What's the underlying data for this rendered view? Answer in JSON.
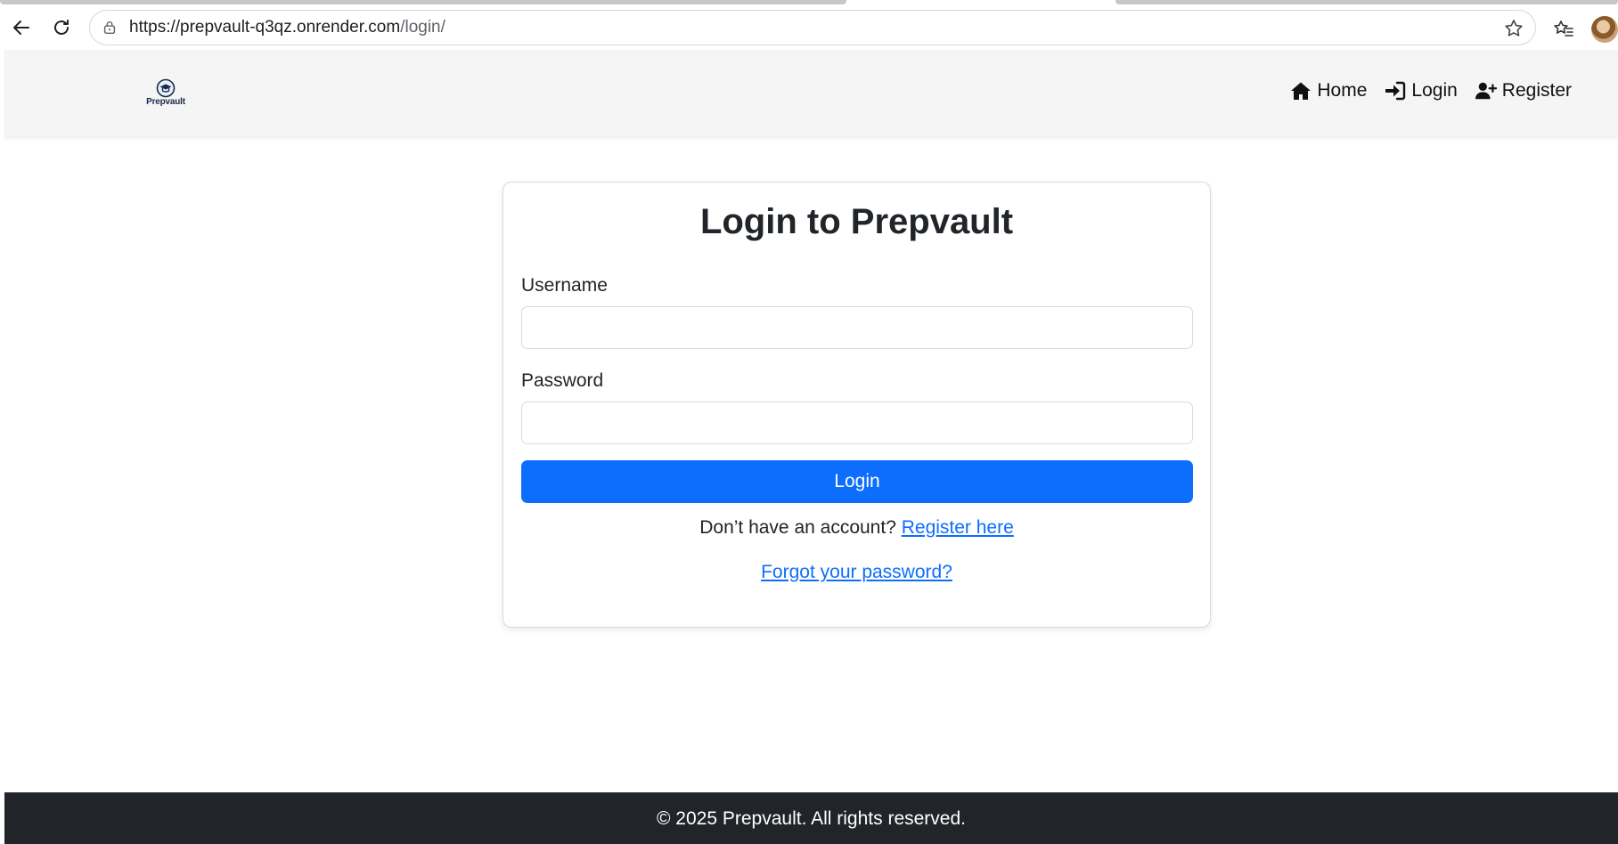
{
  "browser": {
    "url_host": "https://prepvault-q3qz.onrender.com",
    "url_path": "/login/"
  },
  "navbar": {
    "logo_text": "Prepvault",
    "links": [
      {
        "label": "Home",
        "icon": "home-icon"
      },
      {
        "label": "Login",
        "icon": "sign-in-icon"
      },
      {
        "label": "Register",
        "icon": "user-plus-icon"
      }
    ]
  },
  "login_card": {
    "title": "Login to Prepvault",
    "username_label": "Username",
    "username_value": "",
    "password_label": "Password",
    "password_value": "",
    "submit_label": "Login",
    "register_prompt": "Don’t have an account?",
    "register_link": "Register here",
    "forgot_link": "Forgot your password?"
  },
  "footer": {
    "text": "© 2025 Prepvault. All rights reserved."
  },
  "colors": {
    "primary": "#0d6efd",
    "navbar_bg": "#f5f5f5",
    "footer_bg": "#212529"
  }
}
